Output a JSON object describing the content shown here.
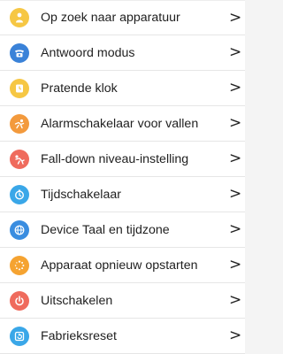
{
  "settings": {
    "items": [
      {
        "label": "Op zoek naar apparatuur",
        "icon": "find-person-icon",
        "color": "#f6c744"
      },
      {
        "label": "Antwoord modus",
        "icon": "telephone-icon",
        "color": "#3a82d8"
      },
      {
        "label": "Pratende klok",
        "icon": "talking-clock-icon",
        "color": "#f6c744"
      },
      {
        "label": "Alarmschakelaar voor vallen",
        "icon": "fall-alarm-icon",
        "color": "#f39a3d"
      },
      {
        "label": "Fall-down niveau-instelling",
        "icon": "fall-level-icon",
        "color": "#ef6b5d"
      },
      {
        "label": "Tijdschakelaar",
        "icon": "timer-icon",
        "color": "#3aa7e8"
      },
      {
        "label": "Device Taal en tijdzone",
        "icon": "globe-icon",
        "color": "#3a8de0"
      },
      {
        "label": "Apparaat opnieuw opstarten",
        "icon": "restart-icon",
        "color": "#f5a331"
      },
      {
        "label": "Uitschakelen",
        "icon": "power-icon",
        "color": "#ef6b5d"
      },
      {
        "label": "Fabrieksreset",
        "icon": "factory-reset-icon",
        "color": "#3aa7e8"
      }
    ],
    "chevron": ">"
  }
}
